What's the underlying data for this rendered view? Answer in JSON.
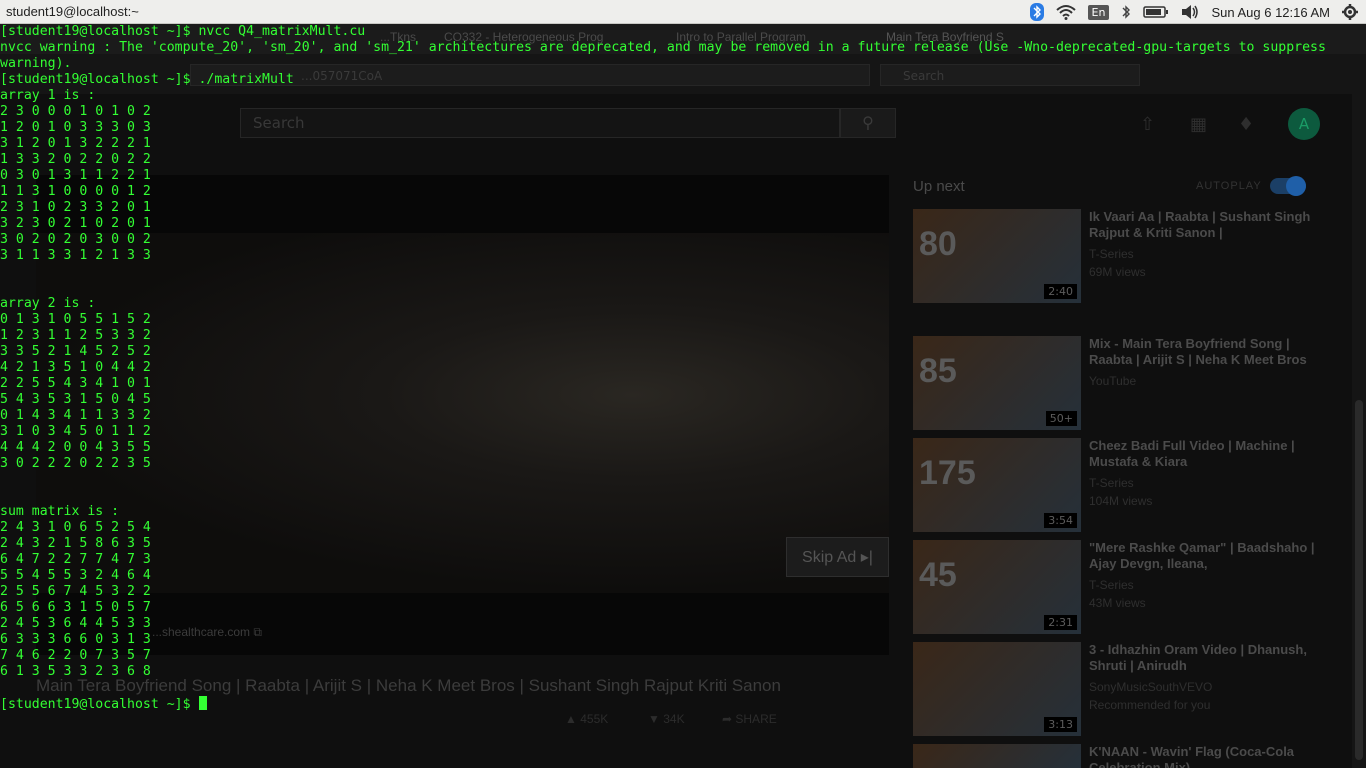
{
  "topbar": {
    "window_title": "student19@localhost:~",
    "lang": "En",
    "clock": "Sun Aug  6 12:16 AM"
  },
  "browser": {
    "tabs": [
      {
        "label": "...Tkns"
      },
      {
        "label": "CO332 - Heterogeneous Prog",
        "active": false
      },
      {
        "label": "Intro to Parallel Program",
        "active": false
      },
      {
        "label": "Main Tera Boyfriend S",
        "active": true
      }
    ],
    "url_fragment": "...057071CoA",
    "search_placeholder": "Search",
    "yt_search_placeholder": "Search",
    "avatar_initial": "A",
    "video": {
      "skip_label": "Skip Ad ▸|",
      "ad_url": "...shealthcare.com ⧉",
      "title": "Main Tera Boyfriend Song | Raabta | Arijit S | Neha K Meet Bros | Sushant Singh Rajput Kriti Sanon",
      "likes": "455K",
      "dislikes": "34K",
      "share": "SHARE"
    },
    "up_next_label": "Up next",
    "autoplay_label": "AUTOPLAY",
    "recommendations": [
      {
        "title": "Ik Vaari Aa | Raabta | Sushant Singh Rajput & Kriti Sanon |",
        "channel": "T-Series",
        "views": "69M views",
        "badge": "80",
        "duration": "2:40"
      },
      {
        "title": "Mix - Main Tera Boyfriend Song | Raabta | Arijit S | Neha K Meet Bros",
        "channel": "YouTube",
        "views": "",
        "badge": "85",
        "duration": "50+"
      },
      {
        "title": "Cheez Badi Full Video | Machine | Mustafa & Kiara",
        "channel": "T-Series",
        "views": "104M views",
        "badge": "175",
        "duration": "3:54"
      },
      {
        "title": "\"Mere Rashke Qamar\" | Baadshaho | Ajay Devgn, Ileana,",
        "channel": "T-Series",
        "views": "43M views",
        "badge": "45",
        "duration": "2:31"
      },
      {
        "title": "3 - Idhazhin Oram Video | Dhanush, Shruti | Anirudh",
        "channel": "SonyMusicSouthVEVO",
        "views": "Recommended for you",
        "badge": "",
        "duration": "3:13"
      },
      {
        "title": "K'NAAN - Wavin' Flag (Coca-Cola Celebration Mix)",
        "channel": "",
        "views": "",
        "badge": "",
        "duration": ""
      }
    ]
  },
  "terminal": {
    "cmd1": "[student19@localhost ~]$ nvcc Q4_matrixMult.cu",
    "warn1": "nvcc warning : The 'compute_20', 'sm_20', and 'sm_21' architectures are deprecated, and may be removed in a future release (Use -Wno-deprecated-gpu-targets to suppress",
    "warn2": "warning).",
    "cmd2": "[student19@localhost ~]$ ./matrixMult",
    "array1_label": "array 1 is :",
    "array1": [
      "2 3 0 0 0 1 0 1 0 2",
      "1 2 0 1 0 3 3 3 0 3",
      "3 1 2 0 1 3 2 2 2 1",
      "1 3 3 2 0 2 2 0 2 2",
      "0 3 0 1 3 1 1 2 2 1",
      "1 1 3 1 0 0 0 0 1 2",
      "2 3 1 0 2 3 3 2 0 1",
      "3 2 3 0 2 1 0 2 0 1",
      "3 0 2 0 2 0 3 0 0 2",
      "3 1 1 3 3 1 2 1 3 3"
    ],
    "array2_label": "array 2 is :",
    "array2": [
      "0 1 3 1 0 5 5 1 5 2",
      "1 2 3 1 1 2 5 3 3 2",
      "3 3 5 2 1 4 5 2 5 2",
      "4 2 1 3 5 1 0 4 4 2",
      "2 2 5 5 4 3 4 1 0 1",
      "5 4 3 5 3 1 5 0 4 5",
      "0 1 4 3 4 1 1 3 3 2",
      "3 1 0 3 4 5 0 1 1 2",
      "4 4 4 2 0 0 4 3 5 5",
      "3 0 2 2 2 0 2 2 3 5"
    ],
    "sum_label": "sum matrix is :",
    "sum": [
      "2 4 3 1 0 6 5 2 5 4",
      "2 4 3 2 1 5 8 6 3 5",
      "6 4 7 2 2 7 7 4 7 3",
      "5 5 4 5 5 3 2 4 6 4",
      "2 5 5 6 7 4 5 3 2 2",
      "6 5 6 6 3 1 5 0 5 7",
      "2 4 5 3 6 4 4 5 3 3",
      "6 3 3 3 6 6 0 3 1 3",
      "7 4 6 2 2 0 7 3 5 7",
      "6 1 3 5 3 3 2 3 6 8"
    ],
    "prompt": "[student19@localhost ~]$ "
  },
  "colors": {
    "terminal_fg": "#33ff33",
    "terminal_bg": "#000000",
    "topbar_bg": "#eeeeec"
  }
}
